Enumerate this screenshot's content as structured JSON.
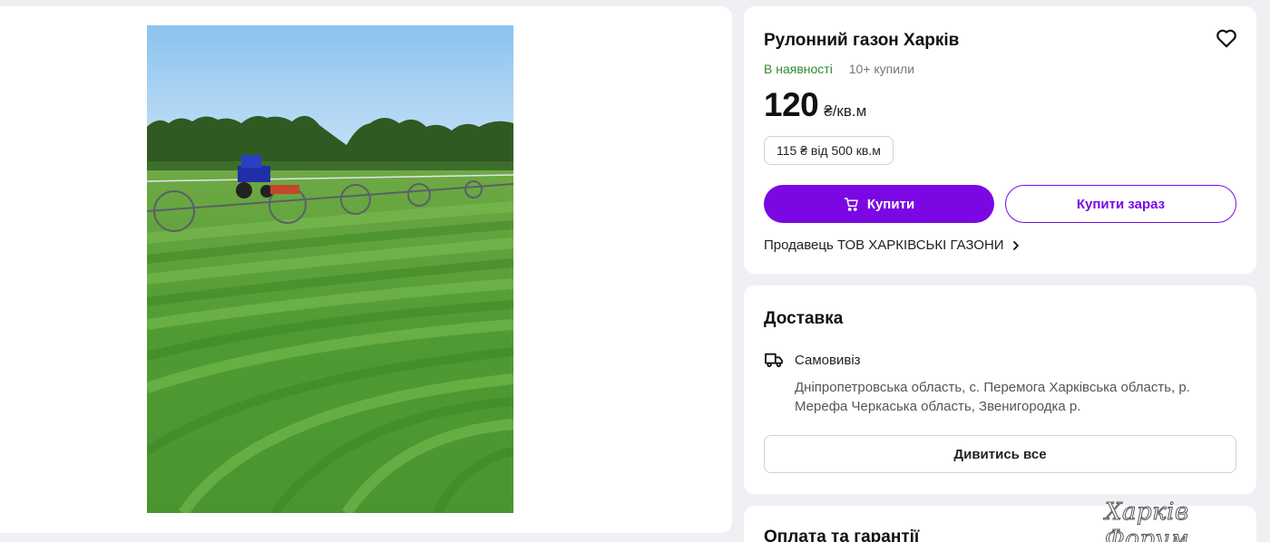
{
  "product": {
    "title": "Рулонний газон Харків",
    "stock_status": "В наявності",
    "bought_count": "10+ купили",
    "price": "120",
    "price_unit": "₴/кв.м",
    "wholesale_price": "115 ₴ від 500 кв.м",
    "buy_label": "Купити",
    "buy_now_label": "Купити зараз",
    "seller_prefix": "Продавець",
    "seller_name": "ТОВ ХАРКІВСЬКІ ГАЗОНИ",
    "icons": {
      "favorite": "heart-icon",
      "cart": "cart-icon",
      "seller_link": "chevron-right-icon"
    }
  },
  "delivery": {
    "title": "Доставка",
    "method": "Самовивіз",
    "locations": "Дніпропетровська область, с. Перемога Харківська область, р. Мерефа Черкаська область, Звенигородка р.",
    "see_all_label": "Дивитись все",
    "icon": "truck-icon"
  },
  "payment": {
    "title": "Оплата та гарантії"
  },
  "watermark": "Харків Форум",
  "colors": {
    "accent": "#7b08e3",
    "in_stock": "#2e8b2e",
    "page_bg": "#eef0f4"
  }
}
